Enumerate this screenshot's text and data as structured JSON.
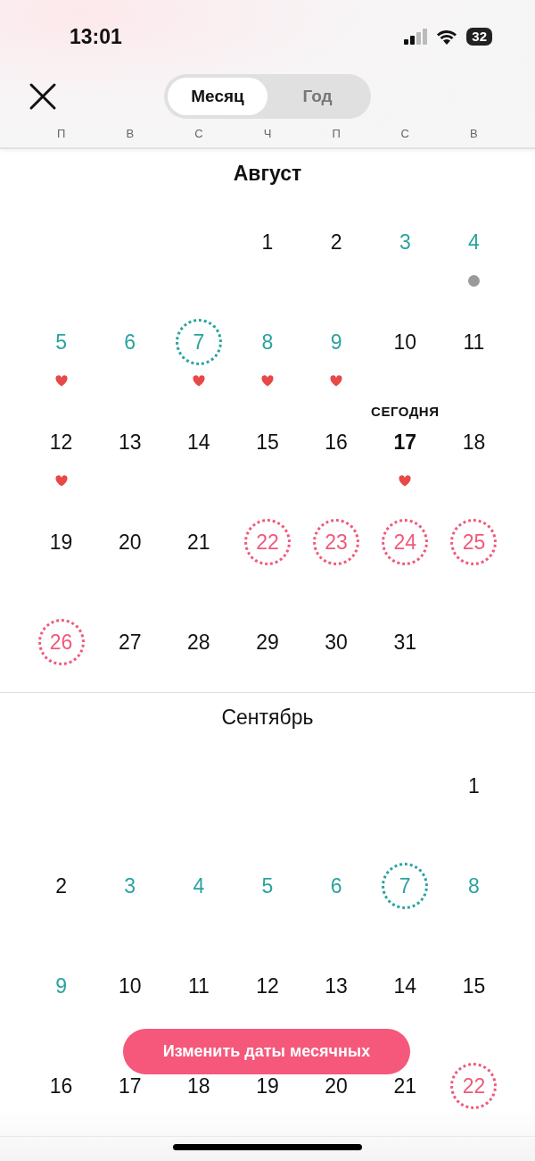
{
  "status_bar": {
    "time": "13:01",
    "battery": "32"
  },
  "segments": [
    {
      "label": "Месяц",
      "selected": true
    },
    {
      "label": "Год",
      "selected": false
    }
  ],
  "weekdays": [
    "П",
    "В",
    "С",
    "Ч",
    "П",
    "С",
    "В"
  ],
  "months": [
    {
      "title": "Август",
      "current": true,
      "weeks": [
        {
          "right_aligned": true,
          "days": [
            {
              "day": "1",
              "kind": "normal"
            },
            {
              "day": "2",
              "kind": "normal"
            },
            {
              "day": "3",
              "kind": "fertile"
            },
            {
              "day": "4",
              "kind": "fertile",
              "dot": true
            }
          ]
        },
        {
          "days": [
            {
              "day": "5",
              "kind": "fertile",
              "heart": true
            },
            {
              "day": "6",
              "kind": "fertile"
            },
            {
              "day": "7",
              "kind": "ovulation",
              "heart": true
            },
            {
              "day": "8",
              "kind": "fertile",
              "heart": true
            },
            {
              "day": "9",
              "kind": "fertile",
              "heart": true
            },
            {
              "day": "10",
              "kind": "normal"
            },
            {
              "day": "11",
              "kind": "normal"
            }
          ]
        },
        {
          "days": [
            {
              "day": "12",
              "kind": "normal",
              "heart": true
            },
            {
              "day": "13",
              "kind": "normal"
            },
            {
              "day": "14",
              "kind": "normal"
            },
            {
              "day": "15",
              "kind": "normal"
            },
            {
              "day": "16",
              "kind": "normal"
            },
            {
              "day": "17",
              "kind": "normal",
              "heart": true,
              "today": true,
              "today_label": "СЕГОДНЯ"
            },
            {
              "day": "18",
              "kind": "normal"
            }
          ]
        },
        {
          "days": [
            {
              "day": "19",
              "kind": "normal"
            },
            {
              "day": "20",
              "kind": "normal"
            },
            {
              "day": "21",
              "kind": "normal"
            },
            {
              "day": "22",
              "kind": "period"
            },
            {
              "day": "23",
              "kind": "period"
            },
            {
              "day": "24",
              "kind": "period"
            },
            {
              "day": "25",
              "kind": "period"
            }
          ]
        },
        {
          "days": [
            {
              "day": "26",
              "kind": "period"
            },
            {
              "day": "27",
              "kind": "normal"
            },
            {
              "day": "28",
              "kind": "normal"
            },
            {
              "day": "29",
              "kind": "normal"
            },
            {
              "day": "30",
              "kind": "normal"
            },
            {
              "day": "31",
              "kind": "normal"
            }
          ]
        }
      ]
    },
    {
      "title": "Сентябрь",
      "current": false,
      "weeks": [
        {
          "right_aligned": true,
          "days": [
            {
              "day": "1",
              "kind": "normal"
            }
          ]
        },
        {
          "days": [
            {
              "day": "2",
              "kind": "normal"
            },
            {
              "day": "3",
              "kind": "fertile"
            },
            {
              "day": "4",
              "kind": "fertile"
            },
            {
              "day": "5",
              "kind": "fertile"
            },
            {
              "day": "6",
              "kind": "fertile"
            },
            {
              "day": "7",
              "kind": "ovulation"
            },
            {
              "day": "8",
              "kind": "fertile"
            }
          ]
        },
        {
          "days": [
            {
              "day": "9",
              "kind": "fertile"
            },
            {
              "day": "10",
              "kind": "normal"
            },
            {
              "day": "11",
              "kind": "normal"
            },
            {
              "day": "12",
              "kind": "normal"
            },
            {
              "day": "13",
              "kind": "normal"
            },
            {
              "day": "14",
              "kind": "normal"
            },
            {
              "day": "15",
              "kind": "normal"
            }
          ]
        },
        {
          "days": [
            {
              "day": "16",
              "kind": "normal"
            },
            {
              "day": "17",
              "kind": "normal"
            },
            {
              "day": "18",
              "kind": "normal"
            },
            {
              "day": "19",
              "kind": "normal"
            },
            {
              "day": "20",
              "kind": "normal"
            },
            {
              "day": "21",
              "kind": "normal"
            },
            {
              "day": "22",
              "kind": "period"
            }
          ]
        }
      ]
    }
  ],
  "action_button": "Изменить даты месячных"
}
